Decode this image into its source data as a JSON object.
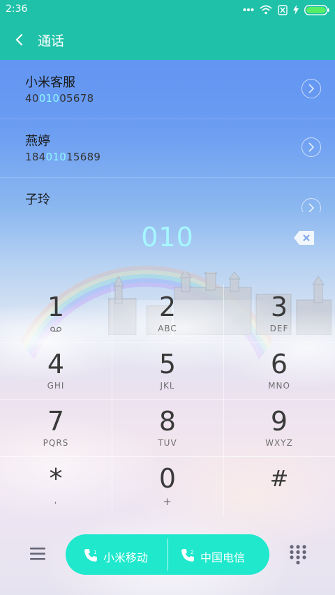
{
  "status_bar": {
    "time": "2:36",
    "icons": [
      "more-icon",
      "wifi-icon",
      "sim-blocked-icon",
      "charging-icon",
      "battery-icon"
    ],
    "battery_color": "#55ee66"
  },
  "header": {
    "title": "通话",
    "background": "#1fc1a8"
  },
  "contacts": [
    {
      "name": "小米客服",
      "number_parts": [
        "40",
        "010",
        "05678"
      ]
    },
    {
      "name": "燕婷",
      "number_parts": [
        "184",
        "010",
        "15689"
      ]
    },
    {
      "name": "子玲"
    }
  ],
  "dialer": {
    "input": "010"
  },
  "keypad": [
    {
      "digit": "1",
      "letters": ""
    },
    {
      "digit": "2",
      "letters": "ABC"
    },
    {
      "digit": "3",
      "letters": "DEF"
    },
    {
      "digit": "4",
      "letters": "GHI"
    },
    {
      "digit": "5",
      "letters": "JKL"
    },
    {
      "digit": "6",
      "letters": "MNO"
    },
    {
      "digit": "7",
      "letters": "PQRS"
    },
    {
      "digit": "8",
      "letters": "TUV"
    },
    {
      "digit": "9",
      "letters": "WXYZ"
    },
    {
      "digit": "*",
      "letters": ","
    },
    {
      "digit": "0",
      "letters": "+"
    },
    {
      "digit": "#",
      "letters": ""
    }
  ],
  "call_buttons": {
    "sim1_label": "小米移动",
    "sim2_label": "中国电信",
    "accent": "#1fe8cd"
  },
  "colors": {
    "highlight": "#8ef6ff"
  }
}
